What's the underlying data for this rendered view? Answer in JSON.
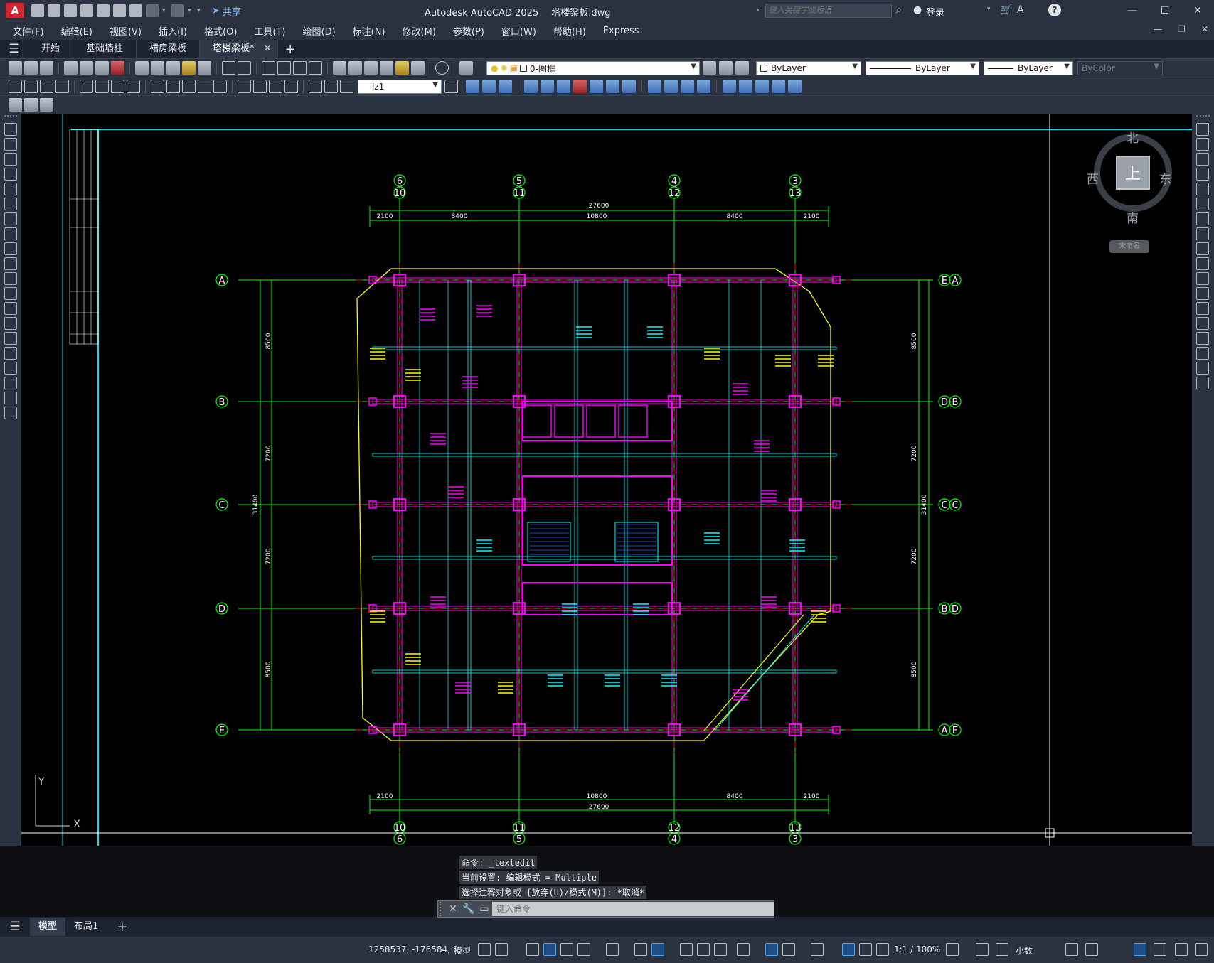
{
  "app": {
    "title": "Autodesk AutoCAD 2025",
    "file": "塔楼梁板.dwg",
    "logo": "A",
    "share": "共享",
    "search_placeholder": "键入关键字或短语",
    "login": "登录"
  },
  "menu": [
    "文件(F)",
    "编辑(E)",
    "视图(V)",
    "插入(I)",
    "格式(O)",
    "工具(T)",
    "绘图(D)",
    "标注(N)",
    "修改(M)",
    "参数(P)",
    "窗口(W)",
    "帮助(H)",
    "Express"
  ],
  "tabs": [
    {
      "label": "开始",
      "active": false
    },
    {
      "label": "基础墙柱",
      "active": false
    },
    {
      "label": "裙房梁板",
      "active": false
    },
    {
      "label": "塔楼梁板*",
      "active": true
    }
  ],
  "toolbar": {
    "layer": "0-图框",
    "color": "ByLayer",
    "linetype": "ByLayer",
    "lineweight": "ByLayer",
    "plotstyle": "ByColor",
    "dimstyle": "lz1"
  },
  "viewcube": {
    "north": "北",
    "south": "南",
    "east": "东",
    "west": "西",
    "face": "上",
    "wcs": "未命名"
  },
  "drawing": {
    "top_axes": [
      {
        "top": "6",
        "bottom": "10"
      },
      {
        "top": "5",
        "bottom": "11"
      },
      {
        "top": "4",
        "bottom": "12"
      },
      {
        "top": "3",
        "bottom": "13"
      }
    ],
    "rows": [
      "A",
      "B",
      "C",
      "D",
      "E"
    ],
    "right_rows": [
      {
        "a": "E",
        "b": "A"
      },
      {
        "a": "D",
        "b": "B"
      },
      {
        "a": "C",
        "b": "C"
      },
      {
        "a": "B",
        "b": "D"
      },
      {
        "a": "A",
        "b": "E"
      }
    ],
    "top_total": "27600",
    "top_dims": [
      "2100",
      "8400",
      "10800",
      "8400",
      "2100"
    ],
    "bottom_total": "27600",
    "bottom_dims": [
      "2100",
      "10800",
      "8400",
      "2100"
    ],
    "left_total": "31400",
    "left_dims": [
      "8500",
      "7200",
      "7200",
      "8500"
    ],
    "right_total": "31400",
    "right_dims": [
      "8500",
      "7200",
      "7200",
      "8500"
    ],
    "ucs_y": "Y",
    "ucs_x": "X"
  },
  "command": {
    "history": [
      "命令: _textedit",
      "当前设置: 编辑模式 = Multiple",
      "选择注释对象或 [放弃(U)/模式(M)]: *取消*"
    ],
    "placeholder": "键入命令"
  },
  "layout_tabs": [
    {
      "label": "模型",
      "active": true
    },
    {
      "label": "布局1",
      "active": false
    }
  ],
  "status": {
    "coords": "1258537, -176584, 0",
    "space": "模型",
    "scale": "1:1 / 100%",
    "units": "小数"
  },
  "colors": {
    "axis": "#00ff00",
    "beam": "#ff00ff",
    "column": "#00ffff",
    "text": "#ffff00",
    "dim": "#00ff00",
    "centerline": "#ff0000",
    "frame": "#00e5ee"
  }
}
